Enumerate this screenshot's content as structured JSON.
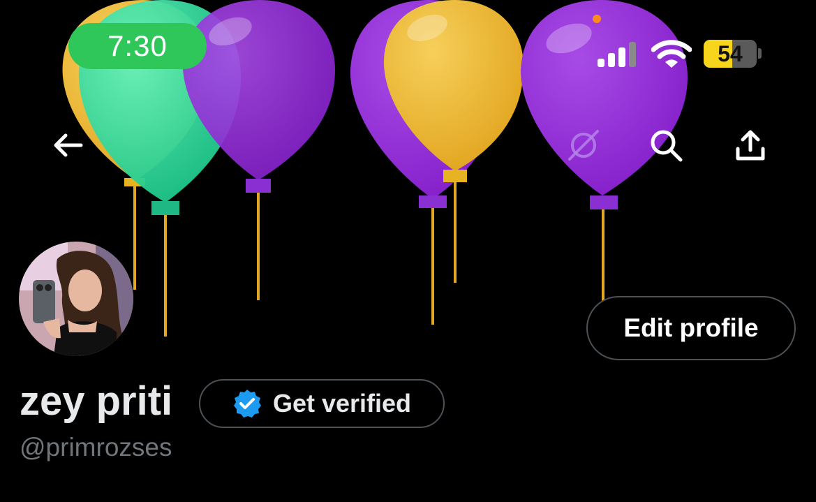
{
  "status_bar": {
    "time": "7:30",
    "battery_level": "54",
    "battery_percent": 54,
    "colors": {
      "time_pill": "#2fc75a",
      "battery": "#f7d51c"
    }
  },
  "nav": {
    "icons": [
      "arrow-left-icon",
      "grok-icon",
      "search-icon",
      "share-icon"
    ]
  },
  "profile": {
    "display_name": "zey priti",
    "handle": "@primrozses",
    "edit_button_label": "Edit profile",
    "verify_button_label": "Get verified",
    "accent_color": "#1d9bf0"
  },
  "banner": {
    "balloon_colors": [
      "#e8b42a",
      "#2ed39a",
      "#8a2fd1",
      "#8a2fd1",
      "#e8b42a",
      "#8a2fd1"
    ]
  }
}
